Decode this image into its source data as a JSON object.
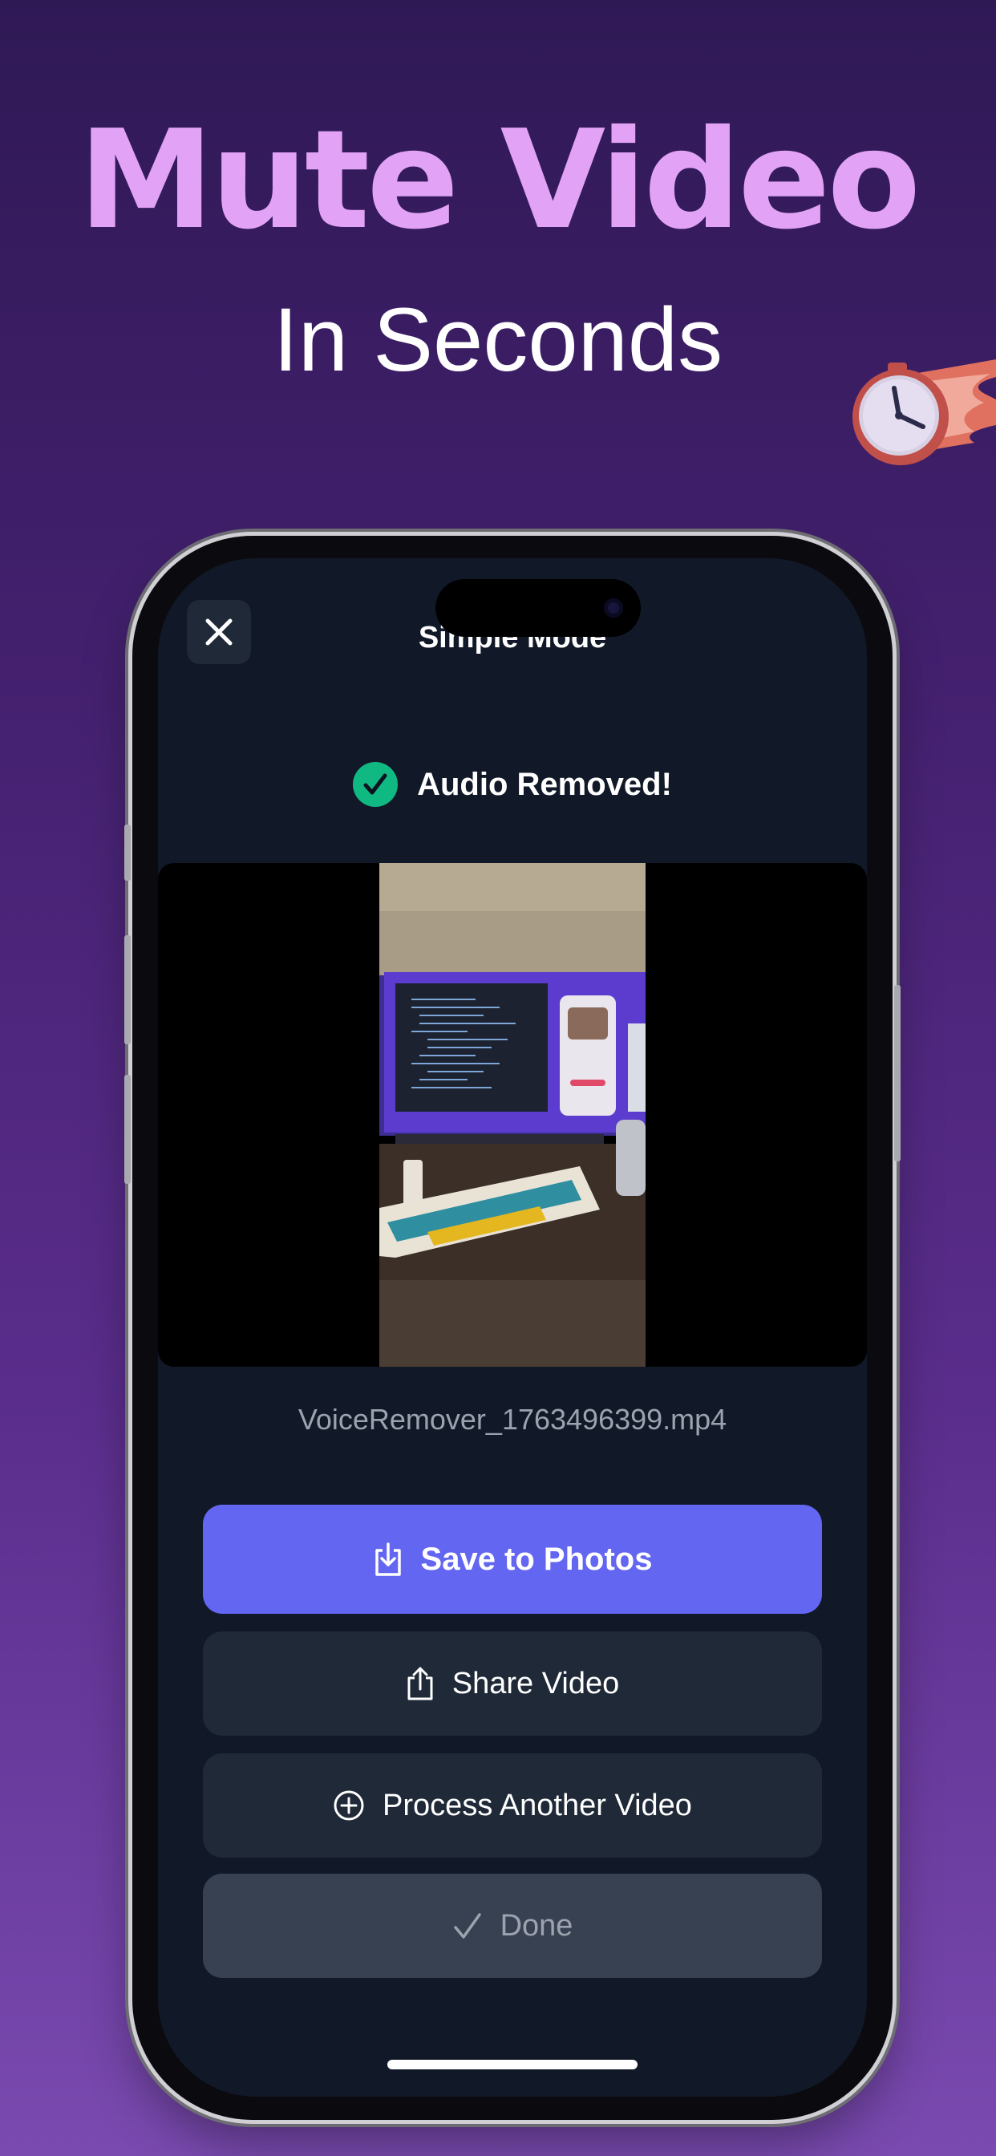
{
  "promo": {
    "headline": "Mute Video",
    "subheadline": "In Seconds"
  },
  "nav": {
    "title": "Simple Mode",
    "close_icon": "close-icon"
  },
  "status": {
    "text": "Audio Removed!",
    "icon": "checkmark-circle-icon",
    "color": "#10b981"
  },
  "video": {
    "file_name": "VoiceRemover_1763496399.mp4"
  },
  "actions": {
    "save_label": "Save to Photos",
    "save_icon": "download-to-device-icon",
    "share_label": "Share Video",
    "share_icon": "share-icon",
    "process_label": "Process Another Video",
    "process_icon": "plus-circle-icon",
    "done_label": "Done",
    "done_icon": "checkmark-icon"
  },
  "colors": {
    "headline": "#e2a3f6",
    "accent": "#6366f1",
    "screen_bg": "#111827",
    "secondary_button": "#1f2937",
    "done_button": "#374151"
  }
}
